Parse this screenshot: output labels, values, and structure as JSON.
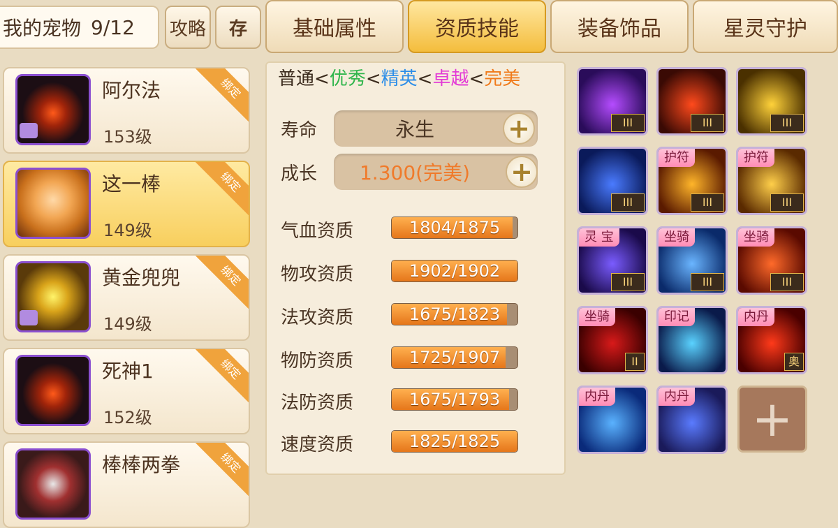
{
  "header": {
    "pets_title": "我的宠物",
    "pets_count": "9/12",
    "guide_label": "攻略",
    "store_label": "存"
  },
  "tabs": [
    {
      "label": "基础属性",
      "active": false
    },
    {
      "label": "资质技能",
      "active": true
    },
    {
      "label": "装备饰品",
      "active": false
    },
    {
      "label": "星灵守护",
      "active": false
    }
  ],
  "pets": [
    {
      "name": "阿尔法",
      "level": "153级",
      "tag": "绑定",
      "avatar": "dark-dragon",
      "selected": false
    },
    {
      "name": "这一棒",
      "level": "149级",
      "tag": "绑定",
      "avatar": "monkey",
      "selected": true
    },
    {
      "name": "黄金兜兜",
      "level": "149级",
      "tag": "绑定",
      "avatar": "golden-bag",
      "selected": false
    },
    {
      "name": "死神1",
      "level": "152级",
      "tag": "绑定",
      "avatar": "dark-dragon",
      "selected": false
    },
    {
      "name": "棒棒两拳",
      "level": "",
      "tag": "绑定",
      "avatar": "fighter",
      "selected": false
    }
  ],
  "grades": [
    {
      "text": "普通",
      "color": "#3a2a1c"
    },
    {
      "text": "优秀",
      "color": "#2fb54b"
    },
    {
      "text": "精英",
      "color": "#2d8ee8"
    },
    {
      "text": "卓越",
      "color": "#e33ad6"
    },
    {
      "text": "完美",
      "color": "#f07a1a"
    }
  ],
  "grade_sep": "<",
  "lifespan": {
    "label": "寿命",
    "value": "永生"
  },
  "growth": {
    "label": "成长",
    "value": "1.300(完美)",
    "color": "#f07a2a"
  },
  "aptitudes": [
    {
      "label": "气血资质",
      "text": "1804/1875",
      "current": 1804,
      "max": 1875
    },
    {
      "label": "物攻资质",
      "text": "1902/1902",
      "current": 1902,
      "max": 1902
    },
    {
      "label": "法攻资质",
      "text": "1675/1823",
      "current": 1675,
      "max": 1823
    },
    {
      "label": "物防资质",
      "text": "1725/1907",
      "current": 1725,
      "max": 1907
    },
    {
      "label": "法防资质",
      "text": "1675/1793",
      "current": 1675,
      "max": 1793
    },
    {
      "label": "速度资质",
      "text": "1825/1825",
      "current": 1825,
      "max": 1825
    }
  ],
  "skills": [
    {
      "icon": "purple-vortex-icon",
      "tag": "",
      "rank": "III",
      "colors": [
        "#2a0c5a",
        "#b54cff"
      ]
    },
    {
      "icon": "red-crystal-icon",
      "tag": "",
      "rank": "III",
      "colors": [
        "#3a0a04",
        "#ff4a1c"
      ]
    },
    {
      "icon": "golden-lightning-icon",
      "tag": "",
      "rank": "III",
      "colors": [
        "#4a3000",
        "#ffd23a"
      ]
    },
    {
      "icon": "blue-phoenix-icon",
      "tag": "",
      "rank": "III",
      "colors": [
        "#0a1a5a",
        "#4a7bff"
      ]
    },
    {
      "icon": "fire-slash-icon",
      "tag": "护符",
      "rank": "III",
      "colors": [
        "#5a1a00",
        "#ffb52a"
      ]
    },
    {
      "icon": "sun-burst-icon",
      "tag": "护符",
      "rank": "III",
      "colors": [
        "#5a2a00",
        "#ffcf4a"
      ]
    },
    {
      "icon": "purple-strike-icon",
      "tag": "灵 宝",
      "rank": "III",
      "colors": [
        "#1a0a4a",
        "#7a5cff"
      ]
    },
    {
      "icon": "blue-swirl-icon",
      "tag": "坐骑",
      "rank": "III",
      "colors": [
        "#0a2a6a",
        "#6ab5ff"
      ]
    },
    {
      "icon": "fire-bird-icon",
      "tag": "坐骑",
      "rank": "III",
      "colors": [
        "#5a0a00",
        "#ff6a2a"
      ]
    },
    {
      "icon": "red-claw-icon",
      "tag": "坐骑",
      "rank": "II",
      "colors": [
        "#3a0000",
        "#d81a1a"
      ]
    },
    {
      "icon": "ice-shard-icon",
      "tag": "印记",
      "rank": "",
      "colors": [
        "#0a1a4a",
        "#5ad2ff"
      ]
    },
    {
      "icon": "red-demon-icon",
      "tag": "内丹",
      "rank": "奥义",
      "colors": [
        "#4a0000",
        "#ff3a1a"
      ]
    },
    {
      "icon": "blue-bubble-icon",
      "tag": "内丹",
      "rank": "",
      "colors": [
        "#0a2a7a",
        "#5ab2ff"
      ]
    },
    {
      "icon": "blue-orb-icon",
      "tag": "内丹",
      "rank": "",
      "colors": [
        "#1a1a5a",
        "#5a7bff"
      ]
    }
  ],
  "add_skill_label": "+"
}
